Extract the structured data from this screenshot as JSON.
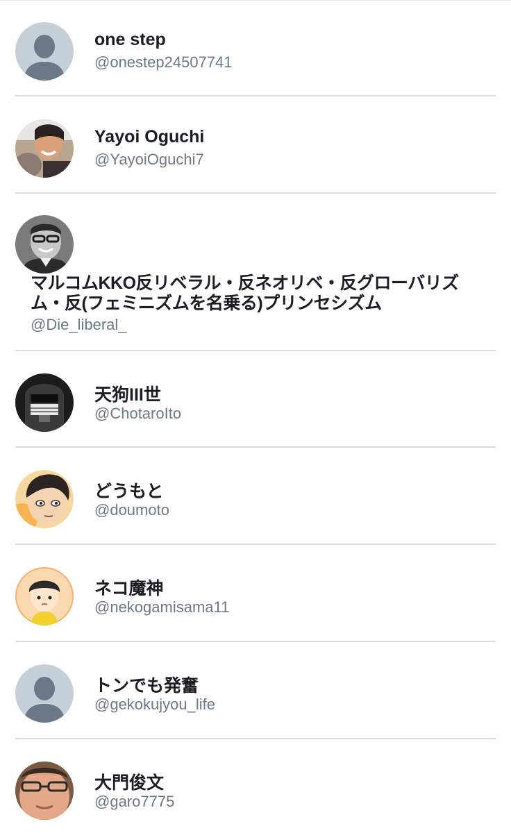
{
  "users": [
    {
      "name": "one step",
      "handle": "@onestep24507741",
      "avatar": "default-avatar-icon"
    },
    {
      "name": "Yayoi Oguchi",
      "handle": "@YayoiOguchi7",
      "avatar": "photo"
    },
    {
      "name": "マルコムKKO反リベラル・反ネオリベ・反グローバリズム・反(フェミニズムを名乗る)プリンセシズム",
      "handle": "@Die_liberal_",
      "avatar": "photo"
    },
    {
      "name": "天狗III世",
      "handle": "@ChotaroIto",
      "avatar": "photo"
    },
    {
      "name": "どうもと",
      "handle": "@doumoto",
      "avatar": "illustration"
    },
    {
      "name": "ネコ魔神",
      "handle": "@nekogamisama11",
      "avatar": "illustration"
    },
    {
      "name": "トンでも発奮",
      "handle": "@gekokujyou_life",
      "avatar": "default-avatar-icon"
    },
    {
      "name": "大門俊文",
      "handle": "@garo7775",
      "avatar": "photo"
    }
  ],
  "colors": {
    "name": "#1a1d21",
    "handle": "#6b7886",
    "divider": "#dcdfe2",
    "default_avatar_bg": "#c5cfd8",
    "default_avatar_fg": "#6b7886"
  }
}
